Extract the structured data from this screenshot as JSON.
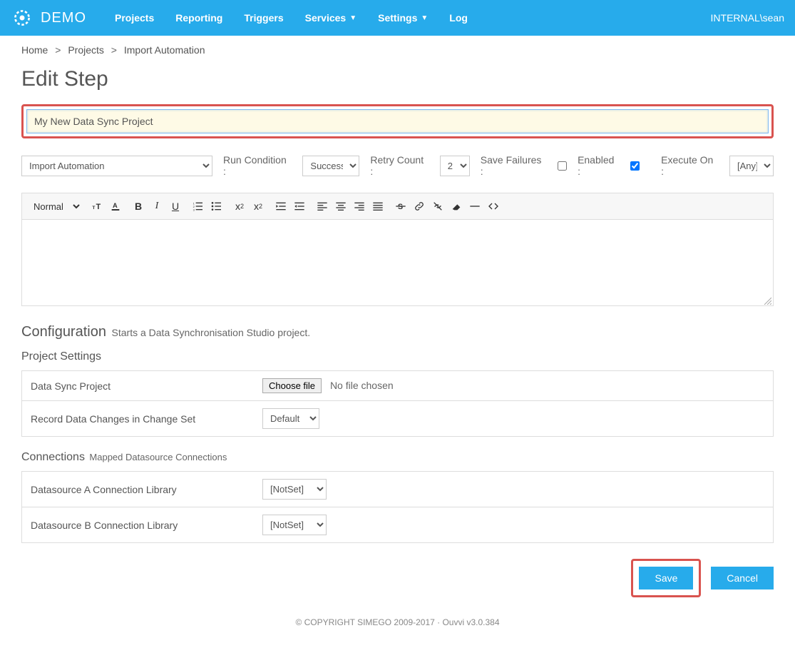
{
  "navbar": {
    "brand": "DEMO",
    "items": [
      {
        "label": "Projects"
      },
      {
        "label": "Reporting"
      },
      {
        "label": "Triggers"
      },
      {
        "label": "Services",
        "dropdown": true
      },
      {
        "label": "Settings",
        "dropdown": true
      },
      {
        "label": "Log"
      }
    ],
    "user": "INTERNAL\\sean"
  },
  "breadcrumb": {
    "items": [
      "Home",
      "Projects",
      "Import Automation"
    ]
  },
  "page_title": "Edit Step",
  "step_name": "My New Data Sync Project",
  "options": {
    "step_type": "Import Automation",
    "run_condition_label": "Run Condition :",
    "run_condition_value": "Success",
    "retry_count_label": "Retry Count :",
    "retry_count_value": "2",
    "save_failures_label": "Save Failures :",
    "save_failures_checked": false,
    "enabled_label": "Enabled :",
    "enabled_checked": true,
    "execute_on_label": "Execute On :",
    "execute_on_value": "[Any]"
  },
  "rte": {
    "style_value": "Normal"
  },
  "config": {
    "heading": "Configuration",
    "sub": "Starts a Data Synchronisation Studio project.",
    "project_settings_heading": "Project Settings",
    "rows": [
      {
        "label": "Data Sync Project",
        "type": "file",
        "button": "Choose file",
        "status": "No file chosen"
      },
      {
        "label": "Record Data Changes in Change Set",
        "type": "select",
        "value": "Default"
      }
    ],
    "connections_heading": "Connections",
    "connections_sub": "Mapped Datasource Connections",
    "connection_rows": [
      {
        "label": "Datasource A Connection Library",
        "value": "[NotSet]"
      },
      {
        "label": "Datasource B Connection Library",
        "value": "[NotSet]"
      }
    ]
  },
  "actions": {
    "save": "Save",
    "cancel": "Cancel"
  },
  "footer": "© COPYRIGHT SIMEGO 2009-2017 · Ouvvi v3.0.384"
}
